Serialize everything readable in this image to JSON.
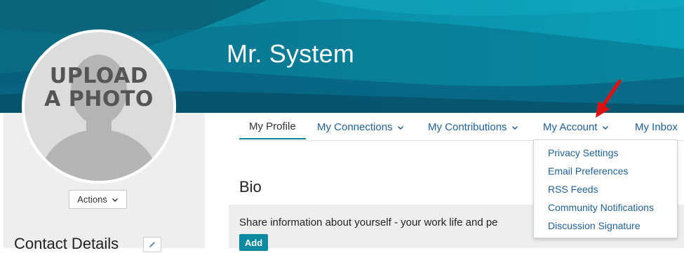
{
  "profile": {
    "user_name": "Mr. System",
    "upload_photo_line1": "UPLOAD",
    "upload_photo_line2": "A PHOTO",
    "actions_label": "Actions",
    "contact_details_title": "Contact Details"
  },
  "tabs": [
    {
      "label": "My Profile",
      "active": true
    },
    {
      "label": "My Connections",
      "has_dropdown": true
    },
    {
      "label": "My Contributions",
      "has_dropdown": true
    },
    {
      "label": "My Account",
      "has_dropdown": true
    },
    {
      "label": "My Inbox"
    }
  ],
  "account_menu": {
    "items": [
      {
        "label": "Privacy Settings"
      },
      {
        "label": "Email Preferences"
      },
      {
        "label": "RSS Feeds"
      },
      {
        "label": "Community Notifications"
      },
      {
        "label": "Discussion Signature"
      }
    ]
  },
  "bio": {
    "title": "Bio",
    "prompt": "Share information about yourself - your work life and pe",
    "add_label": "Add"
  },
  "colors": {
    "banner": "#0a8aa0",
    "link": "#1f5f9c",
    "accent": "#0a8aa0",
    "annotation_arrow": "#e01010"
  },
  "icons": [
    "chevron-down-icon",
    "pencil-icon",
    "avatar-silhouette-icon",
    "red-arrow-annotation"
  ]
}
